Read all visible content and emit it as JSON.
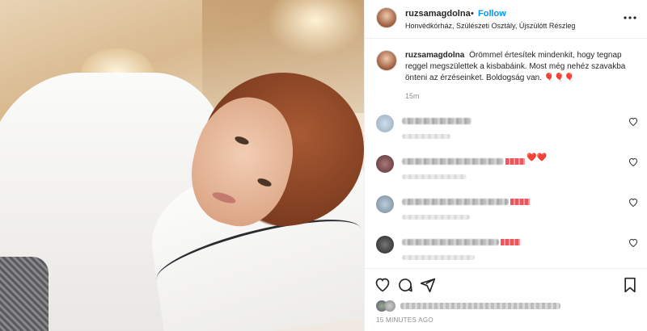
{
  "post": {
    "username": "ruzsamagdolna",
    "follow_label": "Follow",
    "separator": "•",
    "location": "Honvédkórház, Szülészeti Osztály, Újszülött Részleg",
    "more_label": "•••"
  },
  "caption": {
    "username": "ruzsamagdolna",
    "text": "Örömmel értesítek mindenkit, hogy tegnap reggel megszülettek a kisbabáink. Most még nehéz szavakba önteni az érzéseinket. Boldogság van.",
    "emoji": "🎈🎈🎈",
    "time": "15m"
  },
  "comments": [
    {
      "heart_icon": "heart-outline-icon",
      "emoji": ""
    },
    {
      "heart_icon": "heart-outline-icon",
      "emoji": "❤️❤️"
    },
    {
      "heart_icon": "heart-outline-icon",
      "emoji": ""
    },
    {
      "heart_icon": "heart-outline-icon",
      "emoji": ""
    }
  ],
  "actions": {
    "like_icon": "heart-outline-icon",
    "comment_icon": "comment-icon",
    "share_icon": "paper-plane-icon",
    "save_icon": "bookmark-icon"
  },
  "timestamp": "15 MINUTES AGO",
  "colors": {
    "accent": "#0095f6",
    "text": "#262626",
    "muted": "#8e8e8e"
  }
}
